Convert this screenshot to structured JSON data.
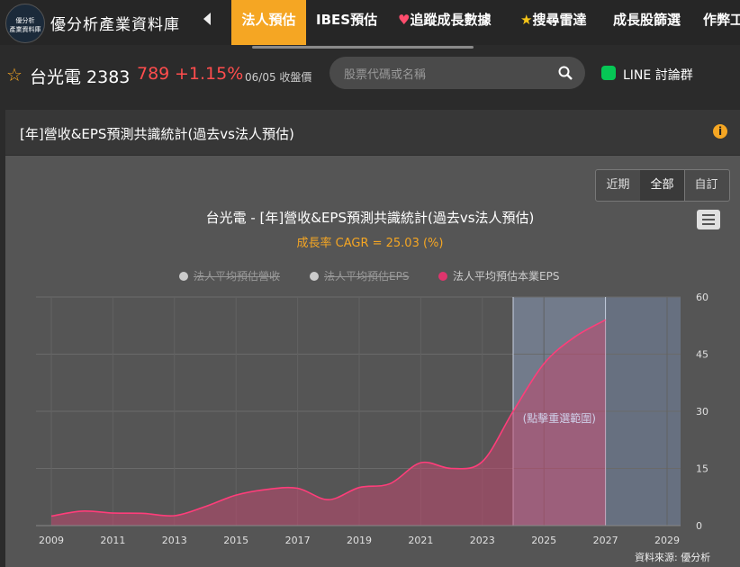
{
  "nav": {
    "brand": "優分析產業資料庫",
    "logo_text_top": "優分析",
    "logo_text_bottom": "產業資料庫",
    "items": [
      {
        "label": "法人預估",
        "active": true
      },
      {
        "label": "IBES預估"
      },
      {
        "label": "追蹤成長數據",
        "icon": "heart-icon"
      },
      {
        "label": "搜尋雷達",
        "icon": "star-icon"
      },
      {
        "label": "成長股篩選"
      },
      {
        "label": "作弊工"
      }
    ]
  },
  "stock": {
    "name": "台光電 2383",
    "price": "789",
    "change": "+1.15%",
    "date": "06/05 收盤價"
  },
  "search": {
    "placeholder": "股票代碼或名稱"
  },
  "line": {
    "label": "LINE 討論群"
  },
  "panel": {
    "title": "[年]營收&EPS預測共識統計(過去vs法人預估)"
  },
  "range_buttons": [
    {
      "label": "近期"
    },
    {
      "label": "全部",
      "active": true
    },
    {
      "label": "自訂"
    }
  ],
  "chart_data": {
    "type": "area",
    "title": "台光電 - [年]營收&EPS預測共識統計(過去vs法人預估)",
    "subtitle": "成長率 CAGR = 25.03 (%)",
    "legend": [
      {
        "name": "法人平均預估營收",
        "visible": false,
        "color": "#cccccc"
      },
      {
        "name": "法人平均預估EPS",
        "visible": false,
        "color": "#cccccc"
      },
      {
        "name": "法人平均預估本業EPS",
        "visible": true,
        "color": "#e0356d"
      }
    ],
    "x_ticks": [
      "2009",
      "2011",
      "2013",
      "2015",
      "2017",
      "2019",
      "2021",
      "2023",
      "2025",
      "2027",
      "2029"
    ],
    "y_ticks": [
      "60",
      "45",
      "30",
      "15",
      "0"
    ],
    "ylim": [
      0,
      60
    ],
    "xlim": [
      2009,
      2029.5
    ],
    "series": [
      {
        "name": "法人平均預估本業EPS",
        "x": [
          2009,
          2010,
          2011,
          2012,
          2013,
          2014,
          2015,
          2016,
          2017,
          2018,
          2019,
          2020,
          2021,
          2022,
          2023,
          2024,
          2025,
          2026,
          2027
        ],
        "values": [
          2.5,
          3.8,
          3.3,
          3.2,
          2.6,
          5.0,
          8.0,
          9.5,
          9.8,
          6.8,
          10.0,
          11.0,
          16.5,
          15.0,
          16.8,
          30.0,
          42.5,
          49.5,
          54.0
        ]
      }
    ],
    "highlight_band": {
      "from": 2024,
      "to": 2027,
      "label": "(點擊重選範圍)"
    },
    "shaded_future": {
      "from": 2027,
      "to": 2029.5
    },
    "source": "資料來源: 優分析"
  }
}
